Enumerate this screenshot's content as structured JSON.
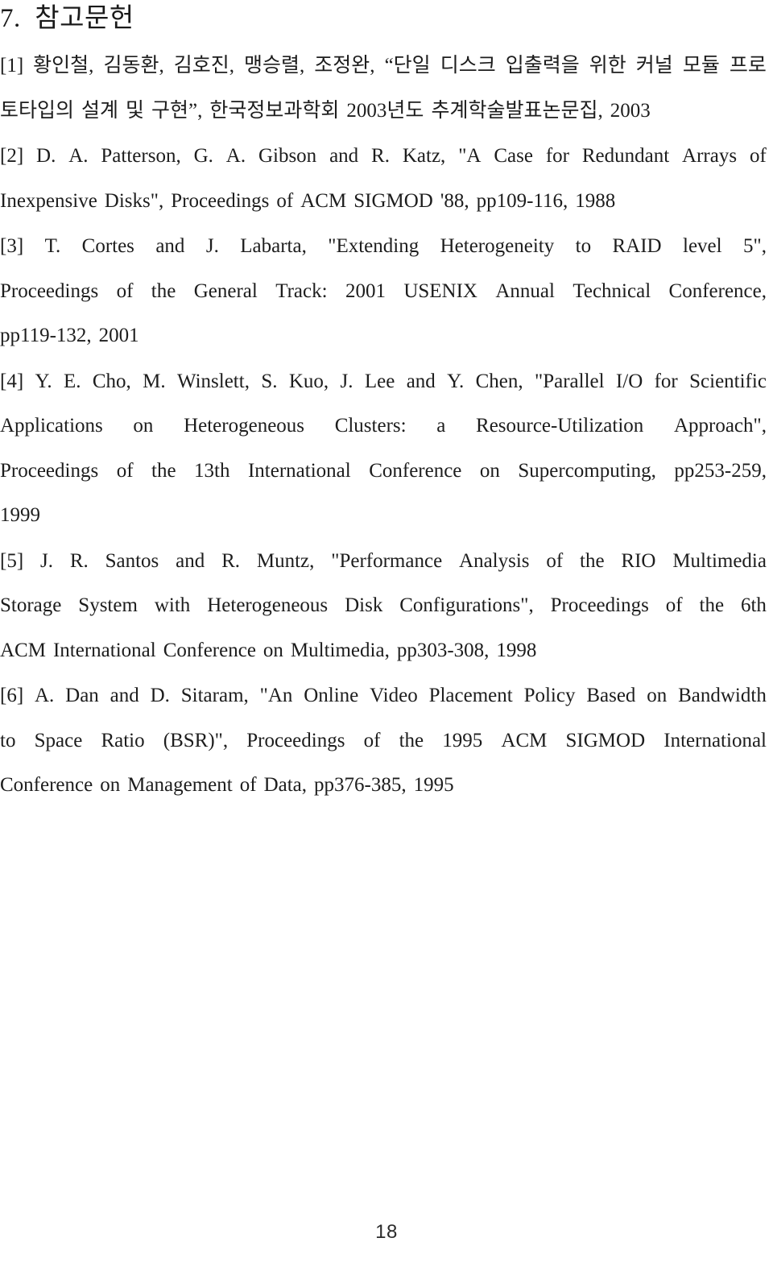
{
  "document": {
    "section_number": "7.",
    "section_title": "참고문헌",
    "heading_full": "7.  참고문헌",
    "page_number": "18",
    "text_color": "#1d1d1d",
    "background_color": "#ffffff"
  },
  "references": [
    {
      "marker": "[1]",
      "full_text": "[1] 황인철, 김동환, 김호진, 맹승렬, 조정완, “단일 디스크 입출력을 위한 커널 모듈 프로토타입의 설계 및 구현”, 한국정보과학회 2003년도 추계학술발표논문집, 2003",
      "lines": [
        {
          "align": "justify",
          "words": [
            "[1]",
            "황인철,",
            "김동환,",
            "김호진,",
            "맹승렬,",
            "조정완,",
            "“단일",
            "디스크",
            "입출력을",
            "위한",
            "커널",
            "모듈",
            "프로"
          ]
        },
        {
          "align": "flush-left",
          "words": [
            "토타입의",
            "설계",
            "및",
            "구현”,",
            "한국정보과학회",
            "2003년도",
            "추계학술발표논문집,",
            "2003"
          ]
        }
      ]
    },
    {
      "marker": "[2]",
      "full_text": "[2] D. A. Patterson, G. A. Gibson and R. Katz, \"A Case for Redundant Arrays of Inexpensive Disks\", Proceedings of ACM SIGMOD '88, pp109-116, 1988",
      "lines": [
        {
          "align": "justify",
          "words": [
            "[2]",
            "D.",
            "A.",
            "Patterson,",
            "G.",
            "A.",
            "Gibson",
            "and",
            "R.",
            "Katz,",
            "\"A",
            "Case",
            "for",
            "Redundant",
            "Arrays",
            "of"
          ]
        },
        {
          "align": "flush-left",
          "words": [
            "Inexpensive",
            "Disks\",",
            "Proceedings",
            "of",
            "ACM",
            "SIGMOD",
            "'88,",
            "pp109-116,",
            "1988"
          ]
        }
      ]
    },
    {
      "marker": "[3]",
      "full_text": "[3] T. Cortes and J. Labarta, \"Extending Heterogeneity to RAID level 5\", Proceedings of the General Track: 2001 USENIX Annual Technical Conference, pp119-132, 2001",
      "lines": [
        {
          "align": "justify",
          "words": [
            "[3]",
            "T.",
            "Cortes",
            "and",
            "J.",
            "Labarta,",
            "\"Extending",
            "Heterogeneity",
            "to",
            "RAID",
            "level",
            "5\","
          ]
        },
        {
          "align": "justify",
          "words": [
            "Proceedings",
            "of",
            "the",
            "General",
            "Track:",
            "2001",
            "USENIX",
            "Annual",
            "Technical",
            "Conference,"
          ]
        },
        {
          "align": "flush-left",
          "words": [
            "pp119-132,",
            "2001"
          ]
        }
      ]
    },
    {
      "marker": "[4]",
      "full_text": "[4] Y. E. Cho, M. Winslett, S. Kuo, J. Lee and Y. Chen, \"Parallel I/O for Scientific Applications on Heterogeneous Clusters: a Resource-Utilization Approach\", Proceedings of the 13th International Conference on Supercomputing, pp253-259, 1999",
      "lines": [
        {
          "align": "justify",
          "words": [
            "[4]",
            "Y.",
            "E.",
            "Cho,",
            "M.",
            "Winslett,",
            "S.",
            "Kuo,",
            "J.",
            "Lee",
            "and",
            "Y.",
            "Chen,",
            "\"Parallel",
            "I/O",
            "for",
            "Scientific"
          ]
        },
        {
          "align": "justify",
          "words": [
            "Applications",
            "on",
            "Heterogeneous",
            "Clusters:",
            "a",
            "Resource-Utilization",
            "Approach\","
          ]
        },
        {
          "align": "justify",
          "words": [
            "Proceedings",
            "of",
            "the",
            "13th",
            "International",
            "Conference",
            "on",
            "Supercomputing,",
            "pp253-259,"
          ]
        },
        {
          "align": "flush-left",
          "words": [
            "1999"
          ]
        }
      ]
    },
    {
      "marker": "[5]",
      "full_text": "[5] J. R. Santos and R. Muntz, \"Performance Analysis of the RIO Multimedia Storage System with Heterogeneous Disk Configurations\", Proceedings of the 6th ACM International Conference on Multimedia, pp303-308, 1998",
      "lines": [
        {
          "align": "justify",
          "words": [
            "[5]",
            "J.",
            "R.",
            "Santos",
            "and",
            "R.",
            "Muntz,",
            "\"Performance",
            "Analysis",
            "of",
            "the",
            "RIO",
            "Multimedia"
          ]
        },
        {
          "align": "justify",
          "words": [
            "Storage",
            "System",
            "with",
            "Heterogeneous",
            "Disk",
            "Configurations\",",
            "Proceedings",
            "of",
            "the",
            "6th"
          ]
        },
        {
          "align": "flush-left",
          "words": [
            "ACM",
            "International",
            "Conference",
            "on",
            "Multimedia,",
            "pp303-308,",
            "1998"
          ]
        }
      ]
    },
    {
      "marker": "[6]",
      "full_text": "[6] A. Dan and D. Sitaram, \"An Online Video Placement Policy Based on Bandwidth to Space Ratio (BSR)\", Proceedings of the 1995 ACM SIGMOD International Conference on Management of Data, pp376-385, 1995",
      "lines": [
        {
          "align": "justify",
          "words": [
            "[6]",
            "A.",
            "Dan",
            "and",
            "D.",
            "Sitaram,",
            "\"An",
            "Online",
            "Video",
            "Placement",
            "Policy",
            "Based",
            "on",
            "Bandwidth"
          ]
        },
        {
          "align": "justify",
          "words": [
            "to",
            "Space",
            "Ratio",
            "(BSR)\",",
            "Proceedings",
            "of",
            "the",
            "1995",
            "ACM",
            "SIGMOD",
            "International"
          ]
        },
        {
          "align": "flush-left",
          "words": [
            "Conference",
            "on",
            "Management",
            "of",
            "Data,",
            "pp376-385,",
            "1995"
          ]
        }
      ]
    }
  ]
}
